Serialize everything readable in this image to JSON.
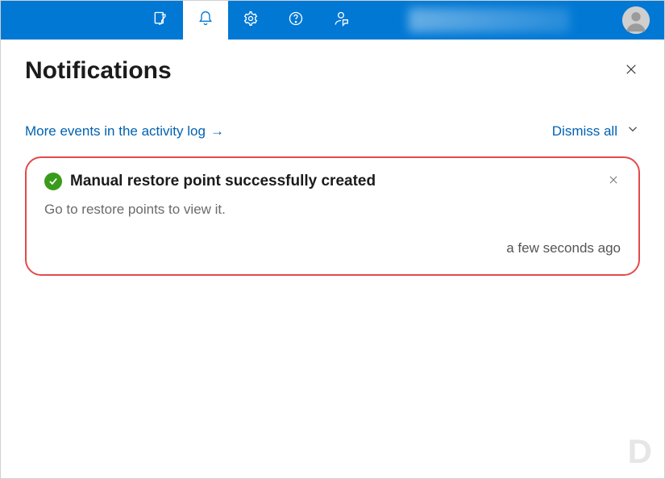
{
  "header": {
    "title": "Notifications"
  },
  "links": {
    "activity_log": "More events in the activity log",
    "dismiss_all": "Dismiss all"
  },
  "notification": {
    "title": "Manual restore point successfully created",
    "body": "Go to restore points to view it.",
    "time": "a few seconds ago"
  },
  "icons": {
    "filter": "filter-icon",
    "bell": "bell-icon",
    "gear": "gear-icon",
    "help": "help-icon",
    "feedback": "feedback-icon",
    "user": "user-avatar",
    "arrow_right": "→",
    "chevron_down": "chevron-down-icon",
    "close": "close-icon",
    "check": "check-icon"
  }
}
